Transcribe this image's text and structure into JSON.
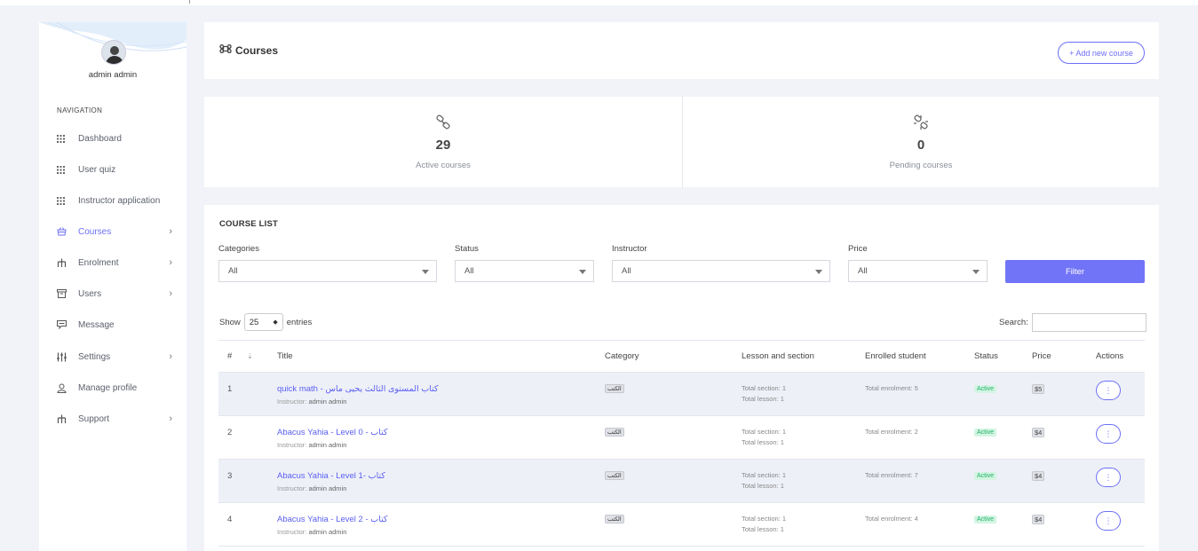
{
  "sidebar": {
    "user_name": "admin admin",
    "nav_heading": "NAVIGATION",
    "items": [
      {
        "label": "Dashboard",
        "icon": "grid-icon",
        "chevron": false
      },
      {
        "label": "User quiz",
        "icon": "grid-icon",
        "chevron": false
      },
      {
        "label": "Instructor application",
        "icon": "grid-icon",
        "chevron": false
      },
      {
        "label": "Courses",
        "icon": "basket-icon",
        "chevron": true,
        "active": true
      },
      {
        "label": "Enrolment",
        "icon": "hierarchy-icon",
        "chevron": true
      },
      {
        "label": "Users",
        "icon": "archive-icon",
        "chevron": true
      },
      {
        "label": "Message",
        "icon": "message-icon",
        "chevron": false
      },
      {
        "label": "Settings",
        "icon": "sliders-icon",
        "chevron": true
      },
      {
        "label": "Manage profile",
        "icon": "user-icon",
        "chevron": false
      },
      {
        "label": "Support",
        "icon": "hierarchy-icon",
        "chevron": true
      }
    ]
  },
  "header": {
    "title": "Courses",
    "add_button": "+ Add new course"
  },
  "stats": {
    "active": {
      "value": "29",
      "label": "Active courses"
    },
    "pending": {
      "value": "0",
      "label": "Pending courses"
    }
  },
  "course_list": {
    "title": "COURSE LIST",
    "filters": {
      "categories": {
        "label": "Categories",
        "value": "All"
      },
      "status": {
        "label": "Status",
        "value": "All"
      },
      "instructor": {
        "label": "Instructor",
        "value": "All"
      },
      "price": {
        "label": "Price",
        "value": "All"
      },
      "filter_button": "Filter"
    },
    "show_label": "Show",
    "entries_value": "25",
    "entries_label": "entries",
    "search_label": "Search:",
    "columns": [
      "#",
      "Title",
      "Category",
      "Lesson and section",
      "Enrolled student",
      "Status",
      "Price",
      "Actions"
    ],
    "rows": [
      {
        "num": "1",
        "title": "quick math - كتاب المستوى الثالث يحيى ماس",
        "instructor_prefix": "Instructor:",
        "instructor": "admin admin",
        "category": "الكتب",
        "section": "Total section:",
        "section_count": "1",
        "lesson": "Total lesson:",
        "lesson_count": "1",
        "enrolment": "Total enrolment:",
        "enrolment_count": "5",
        "status": "Active",
        "price": "$5",
        "action": "⋮"
      },
      {
        "num": "2",
        "title": "Abacus Yahia - Level 0 - كتاب",
        "instructor_prefix": "Instructor:",
        "instructor": "admin admin",
        "category": "الكتب",
        "section": "Total section:",
        "section_count": "1",
        "lesson": "Total lesson:",
        "lesson_count": "1",
        "enrolment": "Total enrolment:",
        "enrolment_count": "2",
        "status": "Active",
        "price": "$4",
        "action": "⋮"
      },
      {
        "num": "3",
        "title": "Abacus Yahia - Level 1- كتاب",
        "instructor_prefix": "Instructor:",
        "instructor": "admin admin",
        "category": "الكتب",
        "section": "Total section:",
        "section_count": "1",
        "lesson": "Total lesson:",
        "lesson_count": "1",
        "enrolment": "Total enrolment:",
        "enrolment_count": "7",
        "status": "Active",
        "price": "$4",
        "action": "⋮"
      },
      {
        "num": "4",
        "title": "Abacus Yahia - Level 2 - كتاب",
        "instructor_prefix": "Instructor:",
        "instructor": "admin admin",
        "category": "الكتب",
        "section": "Total section:",
        "section_count": "1",
        "lesson": "Total lesson:",
        "lesson_count": "1",
        "enrolment": "Total enrolment:",
        "enrolment_count": "4",
        "status": "Active",
        "price": "$4",
        "action": "⋮"
      }
    ]
  },
  "colors": {
    "accent": "#6c6ff5",
    "filter_button": "#7274f7",
    "status_active_bg": "#d3f5e2",
    "status_active_text": "#20b26a",
    "page_bg": "#f1f3f9"
  }
}
